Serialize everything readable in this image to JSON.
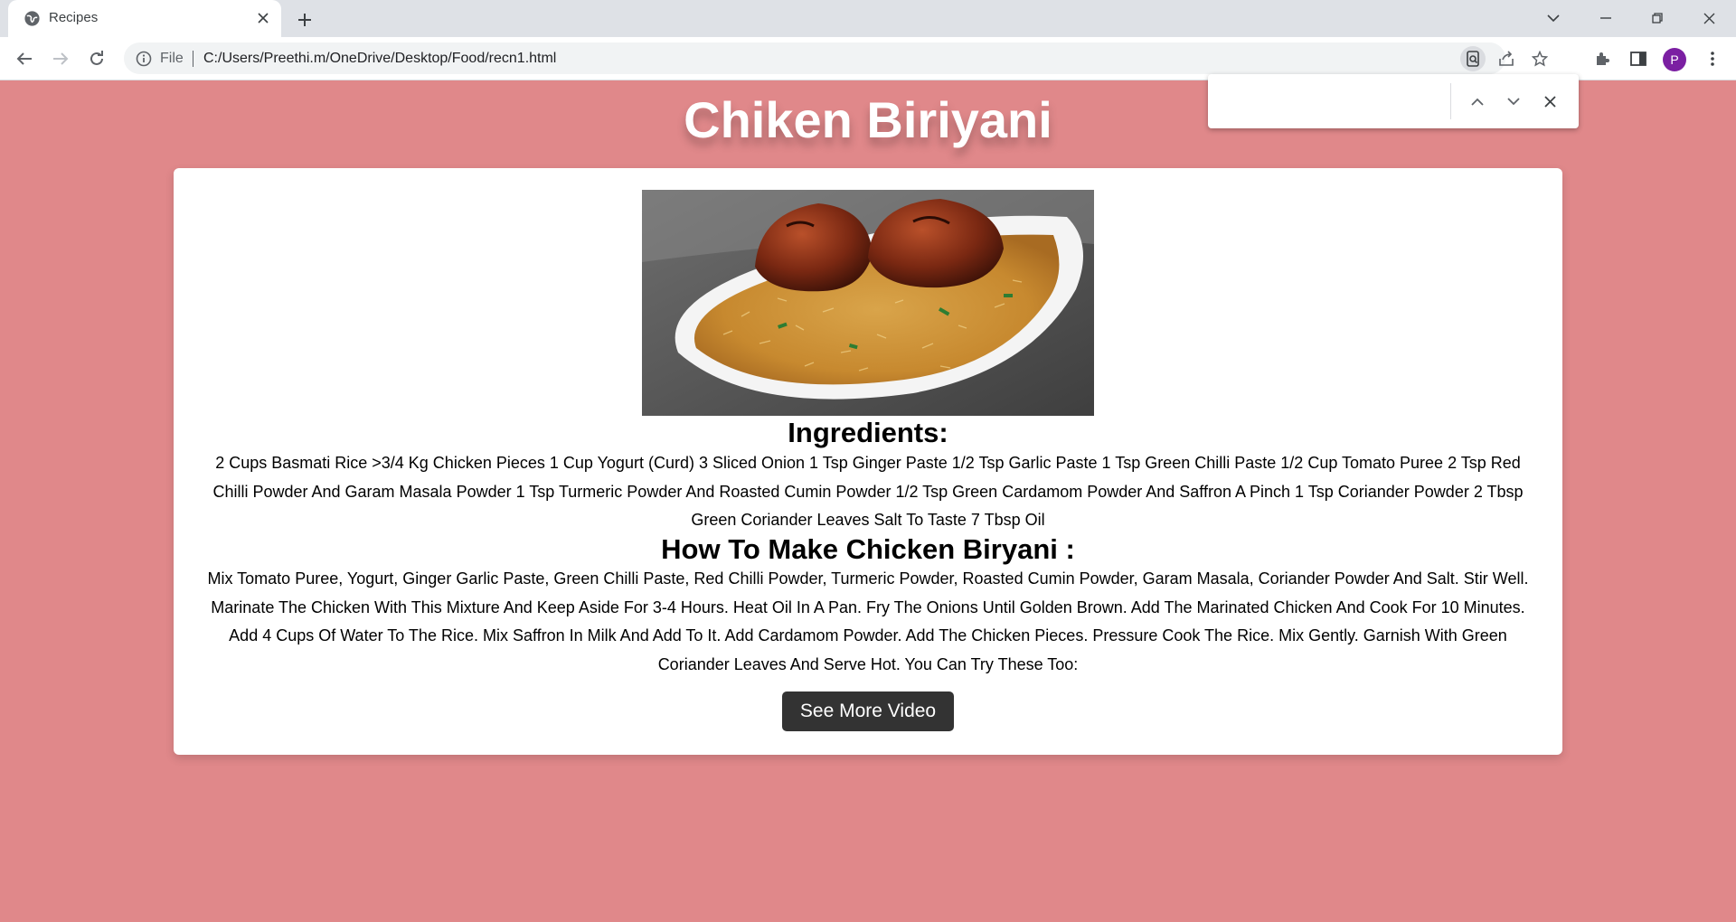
{
  "browser": {
    "tab_title": "Recipes",
    "scheme_label": "File",
    "url": "C:/Users/Preethi.m/OneDrive/Desktop/Food/recn1.html",
    "profile_initial": "P",
    "find_placeholder": ""
  },
  "recipe": {
    "title": "Chiken Biriyani",
    "ingredients_heading": "Ingredients:",
    "ingredients_text": "2 Cups Basmati Rice >3/4 Kg Chicken Pieces 1 Cup Yogurt (Curd) 3 Sliced Onion 1 Tsp Ginger Paste 1/2 Tsp Garlic Paste 1 Tsp Green Chilli Paste 1/2 Cup Tomato Puree 2 Tsp Red Chilli Powder And Garam Masala Powder 1 Tsp Turmeric Powder And Roasted Cumin Powder 1/2 Tsp Green Cardamom Powder And Saffron A Pinch 1 Tsp Coriander Powder 2 Tbsp Green Coriander Leaves Salt To Taste 7 Tbsp Oil",
    "method_heading": "How To Make Chicken Biryani :",
    "method_text": "Mix Tomato Puree, Yogurt, Ginger Garlic Paste, Green Chilli Paste, Red Chilli Powder, Turmeric Powder, Roasted Cumin Powder, Garam Masala, Coriander Powder And Salt. Stir Well. Marinate The Chicken With This Mixture And Keep Aside For 3-4 Hours. Heat Oil In A Pan. Fry The Onions Until Golden Brown. Add The Marinated Chicken And Cook For 10 Minutes. Add 4 Cups Of Water To The Rice. Mix Saffron In Milk And Add To It. Add Cardamom Powder. Add The Chicken Pieces. Pressure Cook The Rice. Mix Gently. Garnish With Green Coriander Leaves And Serve Hot. You Can Try These Too:",
    "button_label": "See More Video"
  },
  "colors": {
    "page_background": "#e0888a",
    "card_background": "#ffffff",
    "button_background": "#333333"
  }
}
